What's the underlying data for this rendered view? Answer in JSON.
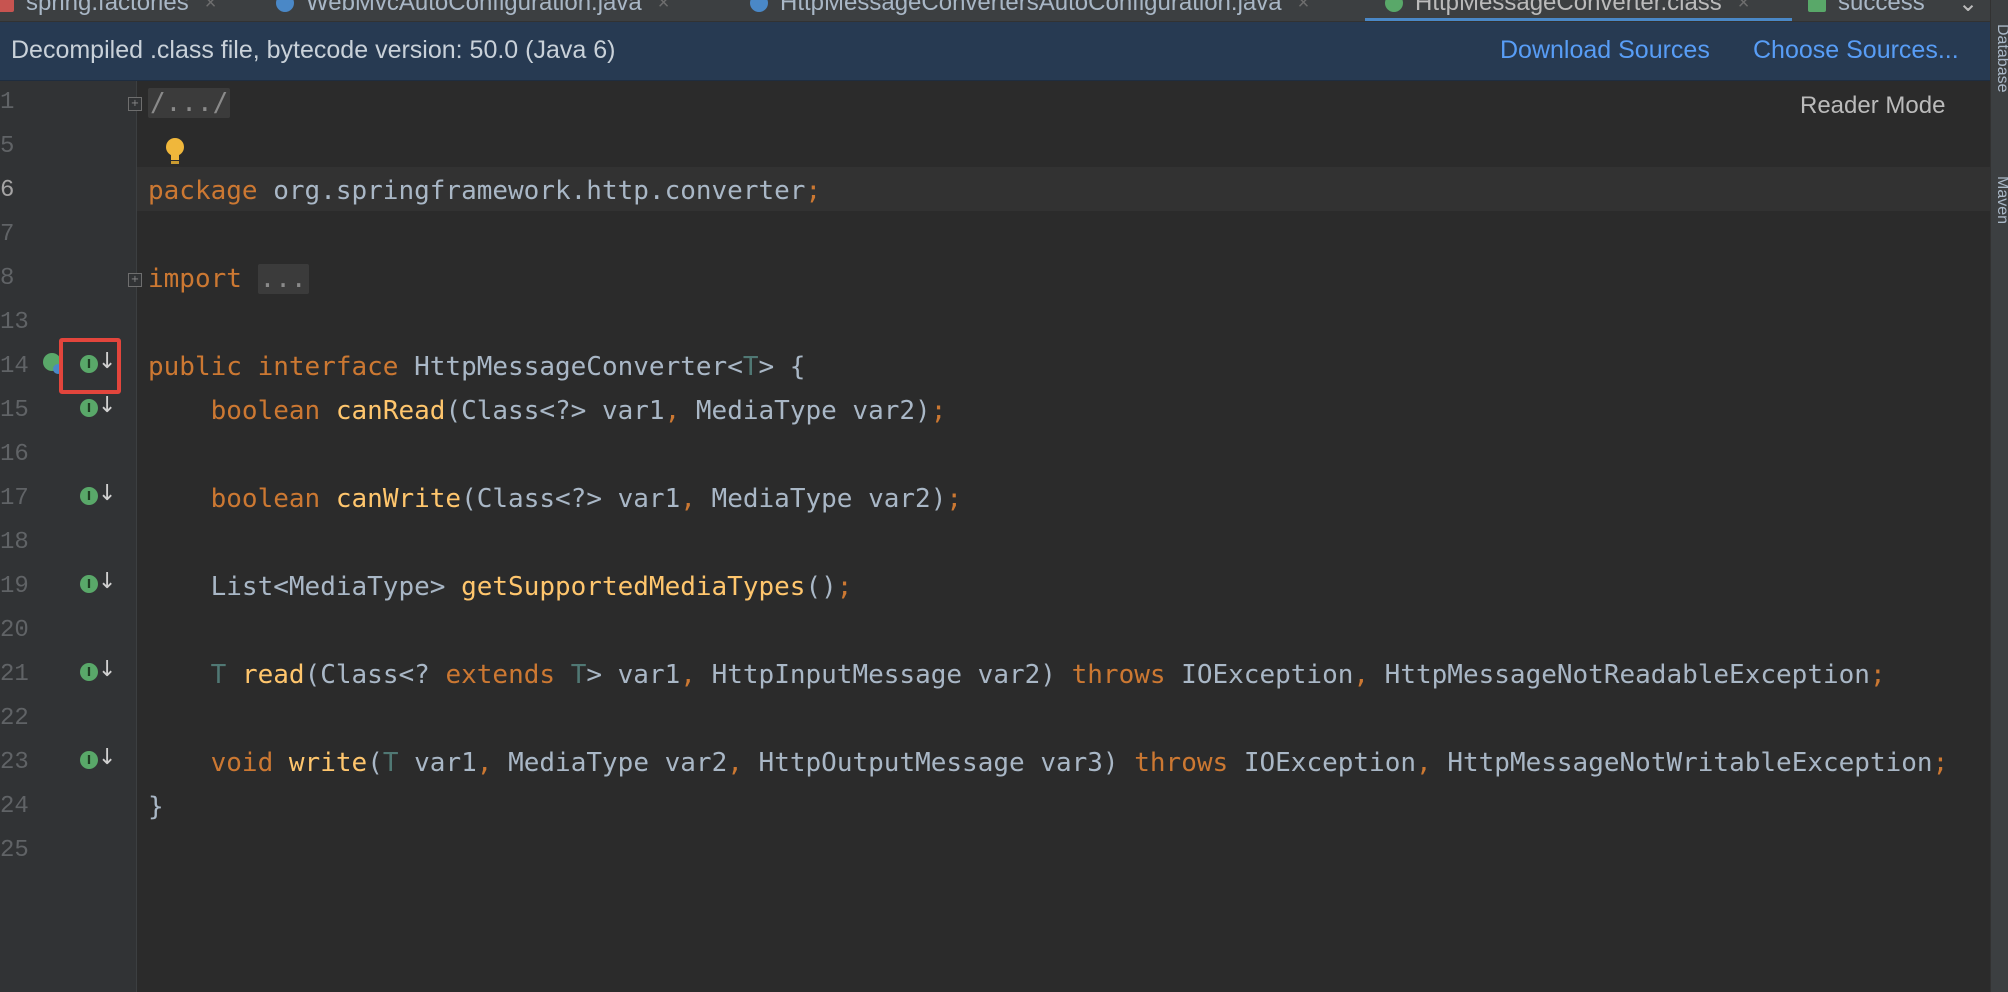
{
  "tabs": [
    {
      "label": "spring.factories",
      "close": "×"
    },
    {
      "label": "WebMvcAutoConfiguration.java",
      "close": "×"
    },
    {
      "label": "HttpMessageConvertersAutoConfiguration.java",
      "close": "×"
    },
    {
      "label": "HttpMessageConverter.class",
      "close": "×",
      "active": true
    },
    {
      "label": "success",
      "close": ""
    }
  ],
  "tab_overflow": "⌄",
  "banner": {
    "text": "Decompiled .class file, bytecode version: 50.0 (Java 6)",
    "download_sources": "Download Sources",
    "choose_sources": "Choose Sources..."
  },
  "reader_mode": "Reader Mode",
  "right_strip": {
    "database": "Database",
    "maven": "Maven"
  },
  "line_numbers": [
    "1",
    "5",
    "6",
    "7",
    "8",
    "13",
    "14",
    "15",
    "16",
    "17",
    "18",
    "19",
    "20",
    "21",
    "22",
    "23",
    "24",
    "25"
  ],
  "current_line": "6",
  "code": {
    "l1": "/.../",
    "l6_kw": "package",
    "l6_rest": " org.springframework.http.converter",
    "semi": ";",
    "l8_kw": "import",
    "l8_fold": "...",
    "l14_public": "public",
    "l14_interface": "interface",
    "l14_name": " HttpMessageConverter<",
    "l14_T": "T",
    "l14_end": "> {",
    "l15_bool": "boolean",
    "l15_fn": "canRead",
    "l15_args": "(Class<?> var1",
    "comma": ",",
    "l15_args2": " MediaType var2)",
    "l17_fn": "canWrite",
    "l19_type": "List<MediaType> ",
    "l19_fn": "getSupportedMediaTypes",
    "l19_end": "()",
    "l21_T": "T",
    "l21_fn": "read",
    "l21_a": "(Class<? ",
    "extends": "extends",
    "l21_b": "> var1",
    "l21_c": " HttpInputMessage var2) ",
    "throws": "throws",
    "l21_ex1": " IOException",
    "l21_ex2": " HttpMessageNotReadableException",
    "l23_void": "void",
    "l23_fn": "write",
    "l23_a": "(",
    "l23_b": " var1",
    "l23_c": " MediaType var2",
    "l23_d": " HttpOutputMessage var3) ",
    "l23_ex2": " HttpMessageNotWritableException",
    "close_brace": "}"
  },
  "icons": {
    "implement": "I",
    "arrow": "↓"
  },
  "colors": {
    "keyword": "#cc7832",
    "method": "#ffc66d",
    "type_param": "#507874",
    "text": "#a9b7c6",
    "link": "#589df6",
    "highlight": "#e2453c",
    "implement_icon": "#59a869"
  }
}
